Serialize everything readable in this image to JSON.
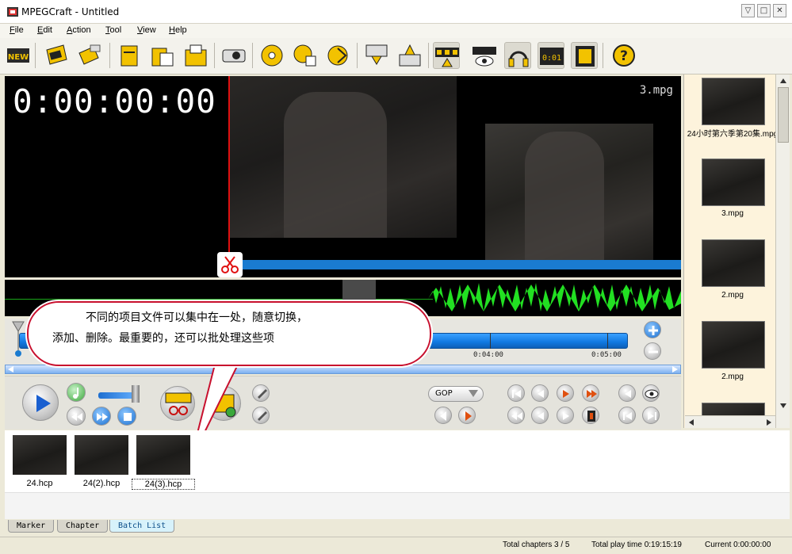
{
  "window": {
    "title": "MPEGCraft - Untitled"
  },
  "menu": [
    {
      "label": "File",
      "u": "F",
      "rest": "ile"
    },
    {
      "label": "Edit",
      "u": "E",
      "rest": "dit"
    },
    {
      "label": "Action",
      "u": "A",
      "rest": "ction"
    },
    {
      "label": "Tool",
      "u": "T",
      "rest": "ool"
    },
    {
      "label": "View",
      "u": "V",
      "rest": "iew"
    },
    {
      "label": "Help",
      "u": "H",
      "rest": "elp"
    }
  ],
  "toolbar": {
    "new_label": "NEW",
    "counter_label": "0:01",
    "help_label": "?"
  },
  "preview": {
    "timecode": "0:00:00:00",
    "clip_name": "3.mpg"
  },
  "timeline": {
    "ticks": [
      "0:04:00",
      "0:05:00"
    ]
  },
  "controls": {
    "gop_label": "GOP"
  },
  "sidebar": {
    "items": [
      {
        "label": "24小时第六季第20集.mpg"
      },
      {
        "label": "3.mpg"
      },
      {
        "label": "2.mpg"
      },
      {
        "label": "2.mpg"
      }
    ]
  },
  "batch": {
    "items": [
      {
        "label": "24.hcp"
      },
      {
        "label": "24(2).hcp"
      },
      {
        "label": "24(3).hcp"
      }
    ]
  },
  "tabs": [
    {
      "label": "Marker"
    },
    {
      "label": "Chapter"
    },
    {
      "label": "Batch List"
    }
  ],
  "status": {
    "chapters": "Total chapters 3 / 5",
    "playtime": "Total play time 0:19:15:19",
    "current": "Current 0:00:00:00"
  },
  "callout": {
    "line1": "不同的项目文件可以集中在一处，随意切换，",
    "line2": "添加、删除。最重要的，还可以批处理这些项"
  },
  "colors": {
    "accent": "#1a7bd0",
    "cut": "#e01010",
    "wave": "#22e022",
    "callout_border": "#c8102e"
  }
}
